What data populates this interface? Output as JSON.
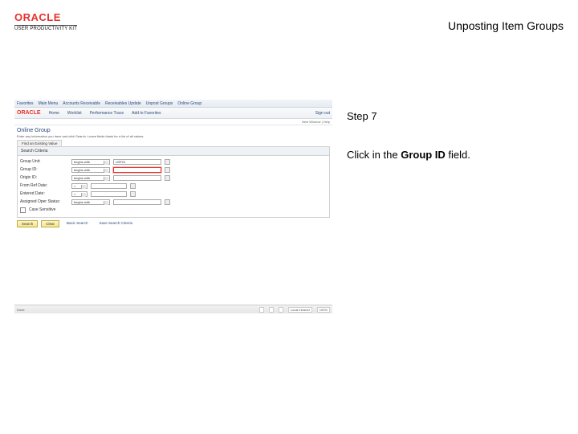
{
  "header": {
    "brand": "ORACLE",
    "brand_sub": "USER PRODUCTIVITY KIT",
    "topic_title": "Unposting Item Groups"
  },
  "instructions": {
    "step_label": "Step 7",
    "text_before": "Click in the ",
    "text_bold": "Group ID",
    "text_after": " field."
  },
  "shot": {
    "topbar": [
      "Favorites",
      "Main Menu",
      "Accounts Receivable",
      "Receivables Update",
      "Unpost Groups",
      "Online Group"
    ],
    "brand": "ORACLE",
    "tabs": [
      "Home",
      "Worklist",
      "Performance Trace",
      "Add to Favorites",
      "Sign out"
    ],
    "sub_right": "New Window | Help",
    "page_title": "Online Group",
    "page_desc": "Enter any information you have and click Search. Leave fields blank for a list of all values.",
    "tab_label": "Find an Existing Value",
    "panel_title": "Search Criteria",
    "rows": {
      "group_unit": {
        "label": "Group Unit:",
        "op": "begins with",
        "value": "USF01"
      },
      "group_id": {
        "label": "Group ID:",
        "op": "begins with",
        "value": ""
      },
      "origin_id": {
        "label": "Origin ID:",
        "op": "begins with",
        "value": ""
      },
      "from_ref": {
        "label": "From Ref Date:",
        "op": "=",
        "value": ""
      },
      "entered_date": {
        "label": "Entered Date:",
        "op": "=",
        "value": ""
      },
      "assign_status": {
        "label": "Assigned Oper Status:",
        "op": "begins with",
        "value": ""
      }
    },
    "case_sensitive": "Case Sensitive",
    "buttons": {
      "search": "Search",
      "clear": "Clear",
      "basic": "Basic Search",
      "save": "Save Search Criteria"
    },
    "status": {
      "done": "Done",
      "zone": "Local intranet",
      "zoom": "100%"
    }
  }
}
